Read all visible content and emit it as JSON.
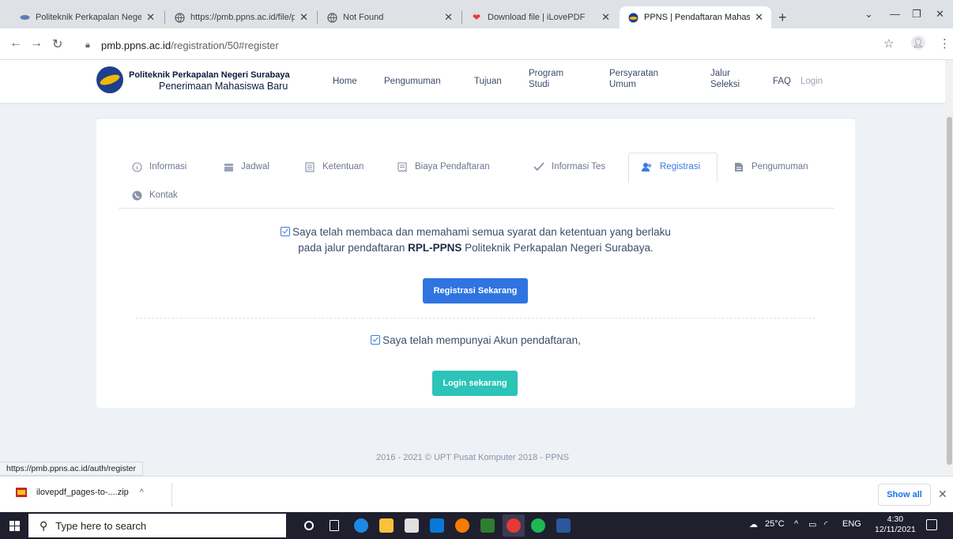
{
  "browser": {
    "tabs": [
      {
        "title": "Politeknik Perkapalan Negeri",
        "favicon": "ppns-icon"
      },
      {
        "title": "https://pmb.ppns.ac.id/file/p",
        "favicon": "globe-icon"
      },
      {
        "title": "Not Found",
        "favicon": "globe-icon"
      },
      {
        "title": "Download file | iLovePDF",
        "favicon": "heart-icon"
      },
      {
        "title": "PPNS | Pendaftaran Mahasisw",
        "favicon": "ppns-icon",
        "active": true
      }
    ],
    "url_host": "pmb.ppns.ac.id",
    "url_path": "/registration/50#register",
    "status_url": "https://pmb.ppns.ac.id/auth/register"
  },
  "site": {
    "brand_line1": "Politeknik Perkapalan Negeri Surabaya",
    "brand_line2": "Penerimaan Mahasiswa Baru",
    "nav": [
      {
        "l1": "Home",
        "l2": ""
      },
      {
        "l1": "Pengumuman",
        "l2": ""
      },
      {
        "l1": "Tujuan",
        "l2": ""
      },
      {
        "l1": "Program",
        "l2": "Studi"
      },
      {
        "l1": "Persyaratan",
        "l2": "Umum"
      },
      {
        "l1": "Jalur",
        "l2": "Seleksi"
      },
      {
        "l1": "FAQ",
        "l2": ""
      },
      {
        "l1": "Login",
        "l2": ""
      }
    ]
  },
  "page_tabs": [
    {
      "label": "Informasi",
      "icon": "info-icon"
    },
    {
      "label": "Jadwal",
      "icon": "calendar-icon"
    },
    {
      "label": "Ketentuan",
      "icon": "document-icon"
    },
    {
      "label": "Biaya Pendaftaran",
      "icon": "receipt-icon"
    },
    {
      "label": "Informasi Tes",
      "icon": "check-icon"
    },
    {
      "label": "Registrasi",
      "icon": "users-icon",
      "active": true
    },
    {
      "label": "Pengumuman",
      "icon": "file-icon"
    },
    {
      "label": "Kontak",
      "icon": "phone-icon"
    }
  ],
  "register": {
    "agree_line1": "Saya telah membaca dan memahami semua syarat dan ketentuan yang berlaku",
    "agree_line2_pre": "pada jalur pendaftaran ",
    "agree_line2_bold": "RPL-PPNS",
    "agree_line2_post": " Politeknik Perkapalan Negeri Surabaya.",
    "register_button": "Registrasi Sekarang",
    "account_text": "Saya telah mempunyai Akun pendaftaran,",
    "login_button": "Login sekarang"
  },
  "footer": "2016 - 2021 © UPT Pusat Komputer 2018 - PPNS",
  "downloads": {
    "file": "ilovepdf_pages-to-....zip",
    "show_all": "Show all"
  },
  "taskbar": {
    "search_placeholder": "Type here to search",
    "temperature": "25°C",
    "language": "ENG",
    "time": "4:30",
    "date": "12/11/2021"
  },
  "colors": {
    "accent": "#2f74e0",
    "teal": "#2cc3b8",
    "brand_navy": "#0b1a3a"
  }
}
